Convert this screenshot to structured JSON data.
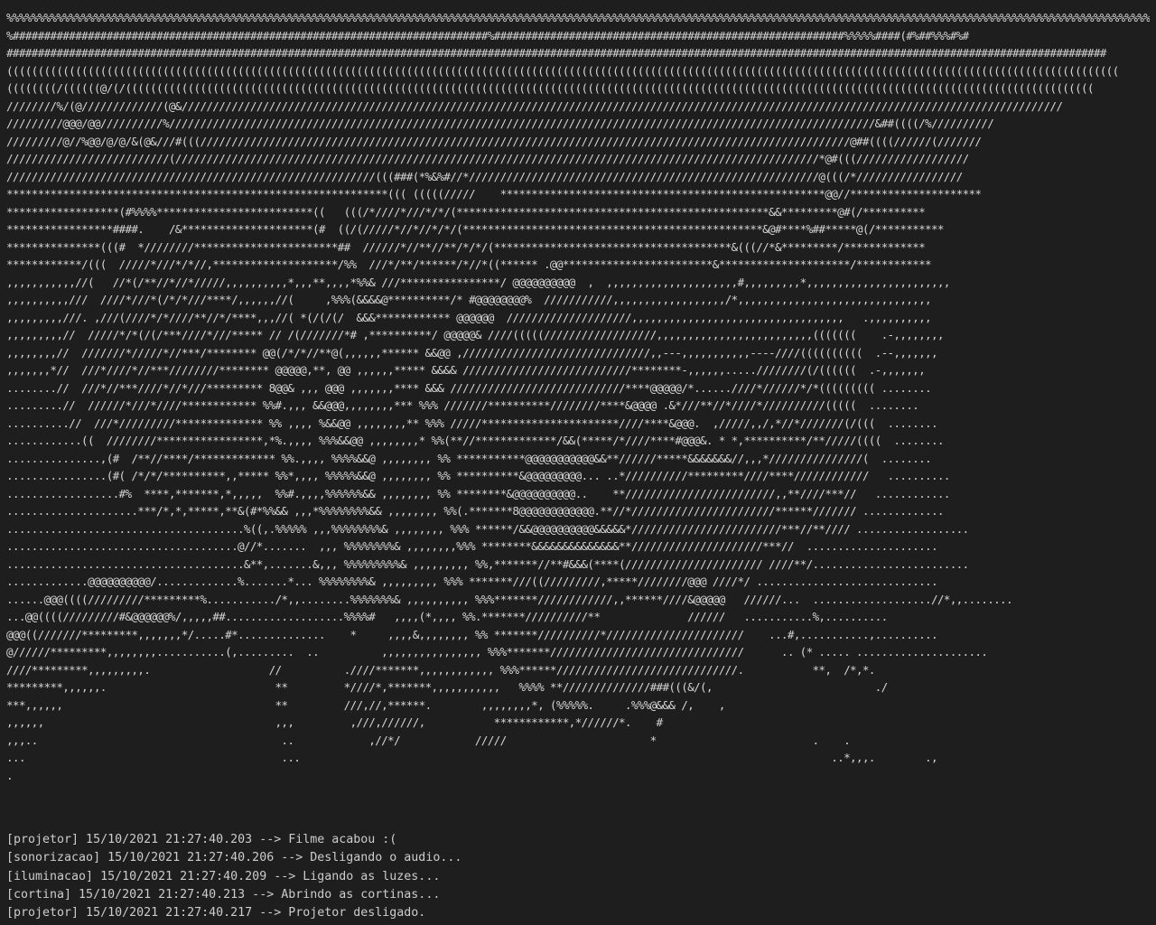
{
  "terminal": {
    "ascii_art": [
      "%%%%%%%%%%%%%%%%%%%%%%%%%%%%%%%%%%%%%%%%%%%%%%%%%%%%%%%%%%%%%%%%%%%%%%%%%%%%%%%%%%%%%%%%%%%%%%%%%%%%%%%%%%%%%%%%%%%%%%%%%%%%%%%%%%%%%%%%%%%%%%%%%%%%%%%%%%%%%%%%%%%%%%%%%%%%%%%%%%%%%%%%%%%%%%%%%%%%%",
      "%############################################################################%########################################################%%%%%####(#%##%%%#%#",
      "################################################################################################################################################################################",
      "((((((((((((((((((((((((((((((((((((((((((((((((((((((((((((((((((((((((((((((((((((((((((((((((((((((((((((((((((((((((((((((((((((((((((((((((((((((((((((((((((((((((((((((((((",
      "((((((((/((((((@/(/(((((((((((((((((((((((((((((((((((((((((((((((((((((((((((((((((((((((((((((((((((((((((((((((((((((((((((((((((((((((((((((((((((((((((((((((((((((((((((",
      "////////%/(@/////////////(@&/////////////////////////////////////////////////////////////////////////////////////////////////////////////////////////////////////////////",
      "/////////@@@/@@//////////%/////////////////////////////////////////////////////////////////////////////////////////////////////////////////&##((((/%//////////",
      "/////////@//%@@/@/@/&(@&///#(((////////////////////////////////////////////////////////////////////////////////////////////////////////@##((((//////(///////",
      "//////////////////////////(///////////////////////////////////////////////////////////////////////////////////////////////////////*@#(((//////////////////",
      "///////////////////////////////////////////////////////////(((###(*%&%#//*////////////////////////////////////////////////////////@(((/*/////////////////",
      "*************************************************************((( (((((/////    ****************************************************@@//*********************",
      "******************(#%%%%*************************((   (((/*////*///*/*/(**************************************************&&*********@#(/**********",
      "*****************####.    /&*********************(#  ((/(/////*//*//*/*/(************************************************&@#****%##*****@(/***********",
      "***************(((#  *////////***********************##  //////*//**//**/*/*/(**************************************&(((//*&*********/*************",
      "************/(((  /////*///*/*//,********************/%%  ///*/**/******/*//*((****** .@@************************&*********************/************",
      ",,,,,,,,,,,//(   //*(/**//*//*/////,,,,,,,,,,*,,,**,,,,*%%& ///****************/ @@@@@@@@@@  ,  ,,,,,,,,,,,,,,,,,,,,,#,,,,,,,,,*,,,,,,,,,,,,,,,,,,,,,,,",
      ",,,,,,,,,,///  ////*///*(/*/*///****/,,,,,,//(     ,%%%(&&&&@**********/* #@@@@@@@@%  ///////////,,,,,,,,,,,,,,,,,,/*,,,,,,,,,,,,,,,,,,,,,,,,,,,,,,,",
      ",,,,,,,,,///. ,///(////*/*////**//*/****,,,//( *(/(/(/  &&&************ @@@@@@  ////////////////////,,,,,,,,,,,,,,,,,,,,,,,,,,,,,,,,,,   .,,,,,,,,,,",
      ",,,,,,,,,//  /////*/*(/(/***////*///***** // /(///////*# ,**********/ @@@@@& ////(((((//////////////////,,,,,,,,,,,,,,,,,,,,,,,,,(((((((    .-,,,,,,,,",
      ",,,,,,,,//  ///////*/////*//***/******** @@(/*/*//**@(,,,,,,****** &&@@ ,//////////////////////////////,,---,,,,,,,,,,,----////((((((((((  .--,,,,,,,",
      ",,,,,,,*//  ///*////*//***////////******** @@@@@,**, @@ ,,,,,,***** &&&& ///////////////////////////********-,,,,,,.....////////(/((((((  .-,,,,,,,",
      "........//  ///*//***////*//*///********* 8@@& ,,, @@@ ,,,,,,,**** &&& ////////////////////////////****@@@@@/*......////*//////*/*((((((((( ........",
      ".........//  //////*///*////************ %%#.,,, &&@@@,,,,,,,,*** %%% ///////**********////////****&@@@@ .&*///**//*////*//////////(((((  ........",
      "..........//  ///*/////////************** %% ,,,, %&&@@ ,,,,,,,,** %%% /////**********************////****&@@@.  ,/////,,/,*//*///////(/(((  ........",
      "............((  ////////*****************,*%.,,,, %%%&&@@ ,,,,,,,,* %%(**//*************/&&(*****/*////****#@@@&. * *,**********/**/////((((  ........",
      "...............,(#  /**//****/************* %%.,,,, %%%%&&@ ,,,,,,,, %% ***********@@@@@@@@@@@&&**//////*****&&&&&&&//,,,*///////////////(  ........",
      "................(#( /*/*/**********,,***** %%*,,,, %%%%%&&@ ,,,,,,,, %% **********&@@@@@@@@@... ..*//////////*********////****////////////   ..........",
      "..................#%  ****,*******,*,,,,,  %%#.,,,,%%%%%%&& ,,,,,,,, %% ********&@@@@@@@@@@..    **////////////////////////,,**////***//   ............",
      ".....................***/*,*,*****,**&(#*%%&& ,,,*%%%%%%%%&& ,,,,,,,, %%(.*******8@@@@@@@@@@@@.**//*///////////////////////******/////// .............",
      "......................................%((,.%%%%% ,,,%%%%%%%%& ,,,,,,,, %%% ******/&&@@@@@@@@@@&&&&&*////////////////////////***//**//// ..................",
      ".....................................@//*.......  ,,, %%%%%%%%& ,,,,,,,,%%% ********&&&&&&&&&&&&&&**/////////////////////***//  .....................",
      "......................................&**,.......&,,, %%%%%%%%%& ,,,,,,,,, %%,*******//**#&&&(****(////////////////////// ////**/.........................",
      ".............@@@@@@@@@@/.............%.......*... %%%%%%%%& ,,,,,,,,, %%% *******///((/////////,*****////////@@@ ////*/ .............................",
      "......@@@((((/////////*********%.........../*,,........%%%%%%%& ,,,,,,,,,, %%%*******////////////,,******////&@@@@@   //////...  ...................//*,,........",
      "...@@((((/////////#&@@@@@@%/,,,,,##...................%%%%#   ,,,,(*,,,, %%.*******//////////**              //////   ...........%,..........",
      "@@@((///////*********,,,,,,,*/.....#*..............    *     ,,,,&,,,,,,,, %% *******//////////*//////////////////////    ...#,...........,..........",
      "@//////*********,,,,,,,,...........(,.........  ..          ,,,,,,,,,,,,,,,, %%%*******///////////////////////////////      .. (* ..... .....................",
      "////*********,,,,,,,,,.                   //          .////*******,,,,,,,,,,,, %%%******/////////////////////////////.           **,  /*,*.",
      "*********,,,,,,.                           **         *////*,*******,,,,,,,,,,,   %%%% **//////////////###(((&/(,                          ./",
      "***,,,,,,                                  **         ///,//,******.        ,,,,,,,,*, (%%%%%.     .%%%@&&& /,    ,",
      ",,,,,,                                     ,,,         ,///,//////,           ************,*//////*.    #",
      ",,,..                                       ..            ,//*/            /////                       *                         .    .",
      "...                                         ...                                                                                     ..*,,,.        .,",
      "."
    ],
    "log_lines": [
      "[projetor] 15/10/2021 21:27:40.203 --> Filme acabou :(",
      "[sonorizacao] 15/10/2021 21:27:40.206 --> Desligando o audio...",
      "[iluminacao] 15/10/2021 21:27:40.209 --> Ligando as luzes...",
      "[cortina] 15/10/2021 21:27:40.213 --> Abrindo as cortinas...",
      "[projetor] 15/10/2021 21:27:40.217 --> Projetor desligado."
    ]
  },
  "colors": {
    "background": "#1e1e1e",
    "foreground": "#cccccc"
  }
}
